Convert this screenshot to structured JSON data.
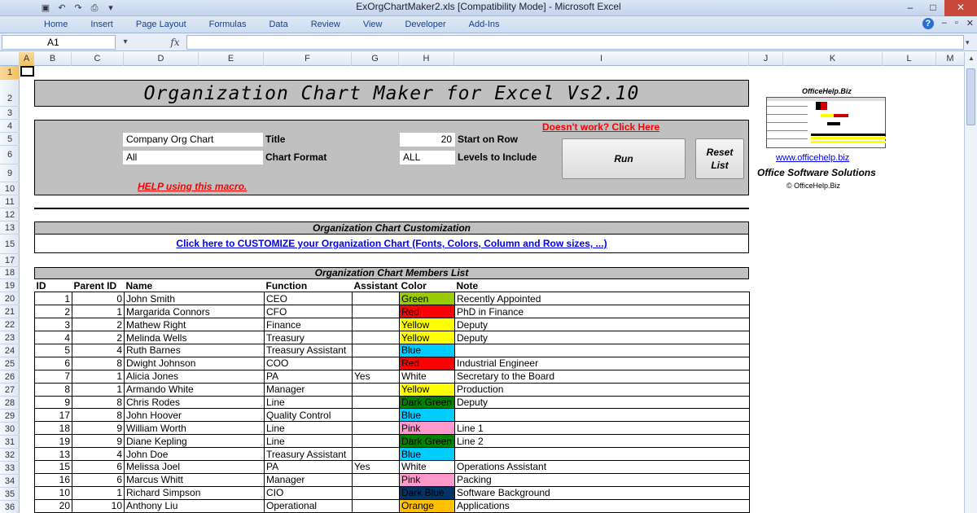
{
  "window": {
    "title": "ExOrgChartMaker2.xls  [Compatibility Mode] - Microsoft Excel",
    "controls": [
      "–",
      "□",
      "✕"
    ]
  },
  "ribbon": {
    "tabs": [
      "Home",
      "Insert",
      "Page Layout",
      "Formulas",
      "Data",
      "Review",
      "View",
      "Developer",
      "Add-Ins"
    ]
  },
  "formula_bar": {
    "name_box": "A1",
    "fx": "fx",
    "value": ""
  },
  "columns": [
    "A",
    "B",
    "C",
    "D",
    "E",
    "F",
    "G",
    "H",
    "I",
    "J",
    "K",
    "L",
    "M"
  ],
  "rows": [
    "1",
    "2",
    "3",
    "4",
    "5",
    "6",
    "9",
    "10",
    "11",
    "12",
    "13",
    "15",
    "17",
    "18",
    "19",
    "20",
    "21",
    "22",
    "23",
    "24",
    "25",
    "26",
    "27",
    "28",
    "29",
    "30",
    "31",
    "32",
    "33",
    "34",
    "35",
    "36"
  ],
  "sheet": {
    "banner_title": "Organization Chart Maker for Excel Vs2.10",
    "title_value": "Company Org Chart",
    "title_label": "Title",
    "format_value": "All",
    "format_label": "Chart Format",
    "start_row_value": "20",
    "start_row_label": "Start on Row",
    "levels_value": "ALL",
    "levels_label": "Levels to Include",
    "doesnt_work_link": "Doesn't work? Click Here",
    "run_button": "Run",
    "reset_button_line1": "Reset",
    "reset_button_line2": "List",
    "help_link": "HELP using this macro.",
    "customization_header": "Organization Chart Customization",
    "customization_link": "Click here to CUSTOMIZE your Organization Chart (Fonts, Colors, Column and Row sizes, ...)",
    "members_header": "Organization Chart  Members List"
  },
  "members": {
    "headers": [
      "ID",
      "Parent ID",
      "Name",
      "Function",
      "Assistant",
      "Color",
      "Note"
    ],
    "rows": [
      {
        "id": "1",
        "parent": "0",
        "name": "John Smith",
        "function": "CEO",
        "assistant": "",
        "color": "Green",
        "bg": "#99cc00",
        "fg": "#000000",
        "note": "Recently Appointed"
      },
      {
        "id": "2",
        "parent": "1",
        "name": "Margarida Connors",
        "function": "CFO",
        "assistant": "",
        "color": "Red",
        "bg": "#ff0000",
        "fg": "#000000",
        "note": "PhD in Finance"
      },
      {
        "id": "3",
        "parent": "2",
        "name": "Mathew Right",
        "function": "Finance",
        "assistant": "",
        "color": "Yellow",
        "bg": "#ffff00",
        "fg": "#000000",
        "note": "Deputy"
      },
      {
        "id": "4",
        "parent": "2",
        "name": "Melinda Wells",
        "function": "Treasury",
        "assistant": "",
        "color": "Yellow",
        "bg": "#ffff00",
        "fg": "#000000",
        "note": "Deputy"
      },
      {
        "id": "5",
        "parent": "4",
        "name": "Ruth Barnes",
        "function": "Treasury Assistant",
        "assistant": "",
        "color": "Blue",
        "bg": "#00ccff",
        "fg": "#000000",
        "note": ""
      },
      {
        "id": "6",
        "parent": "8",
        "name": "Dwight Johnson",
        "function": "COO",
        "assistant": "",
        "color": "Red",
        "bg": "#ff0000",
        "fg": "#000000",
        "note": "Industrial Engineer"
      },
      {
        "id": "7",
        "parent": "1",
        "name": "Alicia Jones",
        "function": "PA",
        "assistant": "Yes",
        "color": "White",
        "bg": "#ffffff",
        "fg": "#000000",
        "note": "Secretary to the Board"
      },
      {
        "id": "8",
        "parent": "1",
        "name": "Armando White",
        "function": "Manager",
        "assistant": "",
        "color": "Yellow",
        "bg": "#ffff00",
        "fg": "#000000",
        "note": "Production"
      },
      {
        "id": "9",
        "parent": "8",
        "name": "Chris Rodes",
        "function": "Line",
        "assistant": "",
        "color": "Dark Green",
        "bg": "#008000",
        "fg": "#000000",
        "note": "Deputy"
      },
      {
        "id": "17",
        "parent": "8",
        "name": "John Hoover",
        "function": "Quality Control",
        "assistant": "",
        "color": "Blue",
        "bg": "#00ccff",
        "fg": "#000000",
        "note": ""
      },
      {
        "id": "18",
        "parent": "9",
        "name": "William Worth",
        "function": "Line",
        "assistant": "",
        "color": "Pink",
        "bg": "#ff99cc",
        "fg": "#000000",
        "note": "Line 1"
      },
      {
        "id": "19",
        "parent": "9",
        "name": "Diane Kepling",
        "function": "Line",
        "assistant": "",
        "color": "Dark Green",
        "bg": "#008000",
        "fg": "#000000",
        "note": "Line 2"
      },
      {
        "id": "13",
        "parent": "4",
        "name": "John Doe",
        "function": "Treasury Assistant",
        "assistant": "",
        "color": "Blue",
        "bg": "#00ccff",
        "fg": "#000000",
        "note": ""
      },
      {
        "id": "15",
        "parent": "6",
        "name": "Melissa Joel",
        "function": "PA",
        "assistant": "Yes",
        "color": "White",
        "bg": "#ffffff",
        "fg": "#000000",
        "note": "Operations Assistant"
      },
      {
        "id": "16",
        "parent": "6",
        "name": "Marcus Whitt",
        "function": "Manager",
        "assistant": "",
        "color": "Pink",
        "bg": "#ff99cc",
        "fg": "#000000",
        "note": "Packing"
      },
      {
        "id": "10",
        "parent": "1",
        "name": "Richard Simpson",
        "function": "CIO",
        "assistant": "",
        "color": "Dark Blue",
        "bg": "#003366",
        "fg": "#000000",
        "note": "Software Background"
      },
      {
        "id": "20",
        "parent": "10",
        "name": "Anthony Liu",
        "function": "Operational",
        "assistant": "",
        "color": "Orange",
        "bg": "#ffc000",
        "fg": "#000000",
        "note": "Applications"
      }
    ]
  },
  "ad": {
    "header": "OfficeHelp.Biz",
    "url": "www.officehelp.biz",
    "tagline": "Office Software Solutions",
    "copyright": "© OfficeHelp.Biz"
  },
  "colors": {
    "panel_gray": "#c0c0c0",
    "link_blue": "#0000ee",
    "link_red": "#ff0000",
    "select_orange": "#f9d99b"
  }
}
